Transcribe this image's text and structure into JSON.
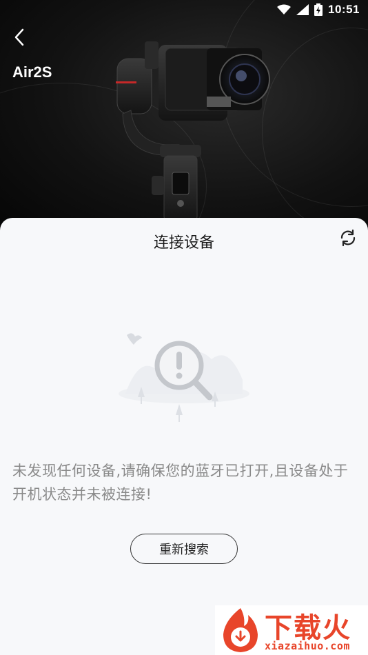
{
  "status_bar": {
    "time": "10:51"
  },
  "header": {
    "device_name": "Air2S"
  },
  "sheet": {
    "title": "连接设备",
    "empty_message": "未发现任何设备,请确保您的蓝牙已打开,且设备处于开机状态并未被连接!",
    "rescan_label": "重新搜索"
  },
  "watermark": {
    "cn_text": "下载火",
    "en_text": "xiazaihuo.com"
  },
  "colors": {
    "watermark": "#e8452a",
    "sheet_bg": "#f7f8fa",
    "text_muted": "#8a8a8a"
  }
}
